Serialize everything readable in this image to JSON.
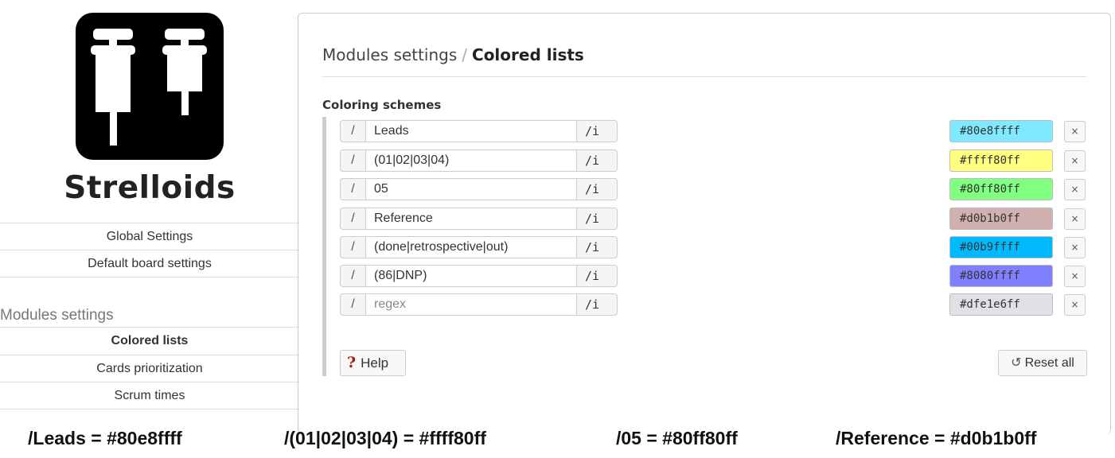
{
  "sidebar": {
    "logo_text": "Strelloids",
    "nav": [
      {
        "label": "Global Settings"
      },
      {
        "label": "Default board settings"
      }
    ],
    "section_title": "Modules settings",
    "modules": [
      {
        "label": "Colored lists",
        "active": true
      },
      {
        "label": "Cards prioritization",
        "active": false
      },
      {
        "label": "Scrum times",
        "active": false
      }
    ]
  },
  "main": {
    "breadcrumb_parent": "Modules settings",
    "breadcrumb_separator": "/",
    "breadcrumb_current": "Colored lists",
    "subtitle": "Coloring schemes",
    "schemes": [
      {
        "slash": "/",
        "pattern": "Leads",
        "flags": "/i",
        "color": "#80e8ffff",
        "bg": "#80e8ff",
        "remove": "×"
      },
      {
        "slash": "/",
        "pattern": "(01|02|03|04)",
        "flags": "/i",
        "color": "#ffff80ff",
        "bg": "#ffff80",
        "remove": "×"
      },
      {
        "slash": "/",
        "pattern": "05",
        "flags": "/i",
        "color": "#80ff80ff",
        "bg": "#80ff80",
        "remove": "×"
      },
      {
        "slash": "/",
        "pattern": "Reference",
        "flags": "/i",
        "color": "#d0b1b0ff",
        "bg": "#d0b1b0",
        "remove": "×"
      },
      {
        "slash": "/",
        "pattern": "(done|retrospective|out)",
        "flags": "/i",
        "color": "#00b9ffff",
        "bg": "#00b9ff",
        "remove": "×"
      },
      {
        "slash": "/",
        "pattern": "(86|DNP)",
        "flags": "/i",
        "color": "#8080ffff",
        "bg": "#8080ff",
        "remove": "×"
      },
      {
        "slash": "/",
        "pattern": "",
        "placeholder": "regex",
        "flags": "/i",
        "color": "#dfe1e6ff",
        "bg": "#dfe1e6",
        "remove": "×"
      }
    ],
    "help_label": "Help",
    "help_icon": "?",
    "reset_label": "Reset all",
    "reset_icon": "↺"
  },
  "captions": [
    "/Leads = #80e8ffff",
    "/(01|02|03|04) = #ffff80ff",
    "/05 = #80ff80ff",
    "/Reference = #d0b1b0ff"
  ]
}
